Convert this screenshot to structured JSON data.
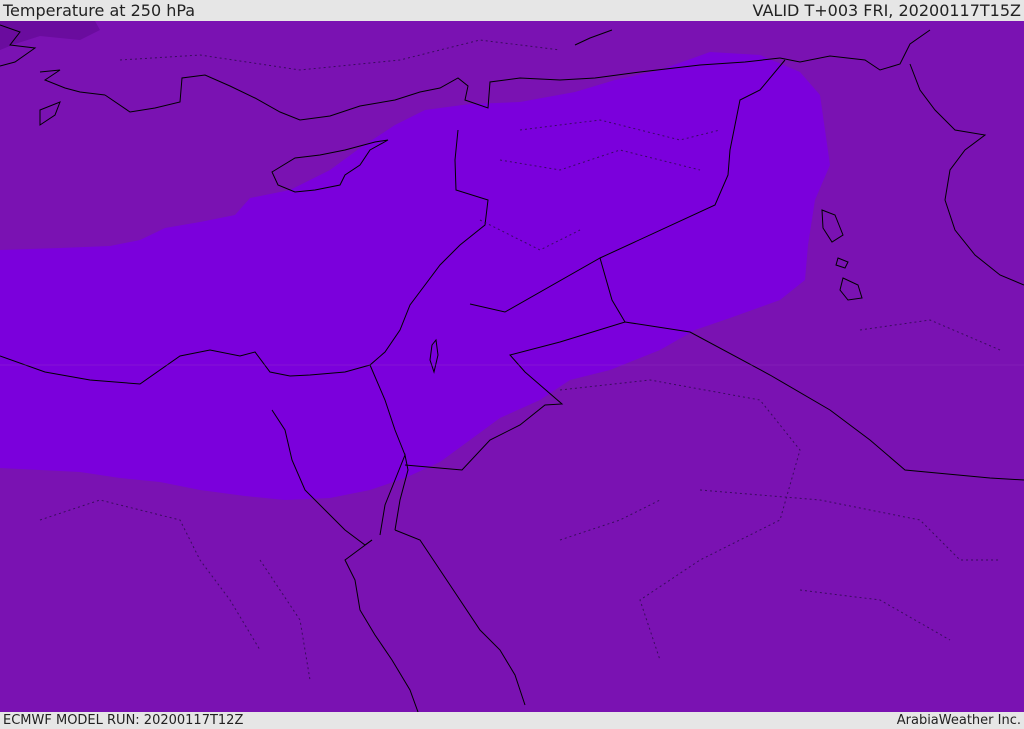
{
  "header": {
    "title": "Temperature at 250 hPa",
    "valid_time": "VALID T+003 FRI, 20200117T15Z"
  },
  "footer": {
    "model_run": "ECMWF MODEL RUN: 20200117T12Z",
    "credit": "ArabiaWeather Inc."
  },
  "map": {
    "field": "temperature_250hpa",
    "colors": {
      "background_band": "#7a12b2",
      "warm_core": "#7b00dc",
      "cold_patch": "#6a0c9e",
      "coastline": "#000000",
      "borders": "#000000",
      "province_lines": "#2a0a4a"
    },
    "legend": "none"
  }
}
